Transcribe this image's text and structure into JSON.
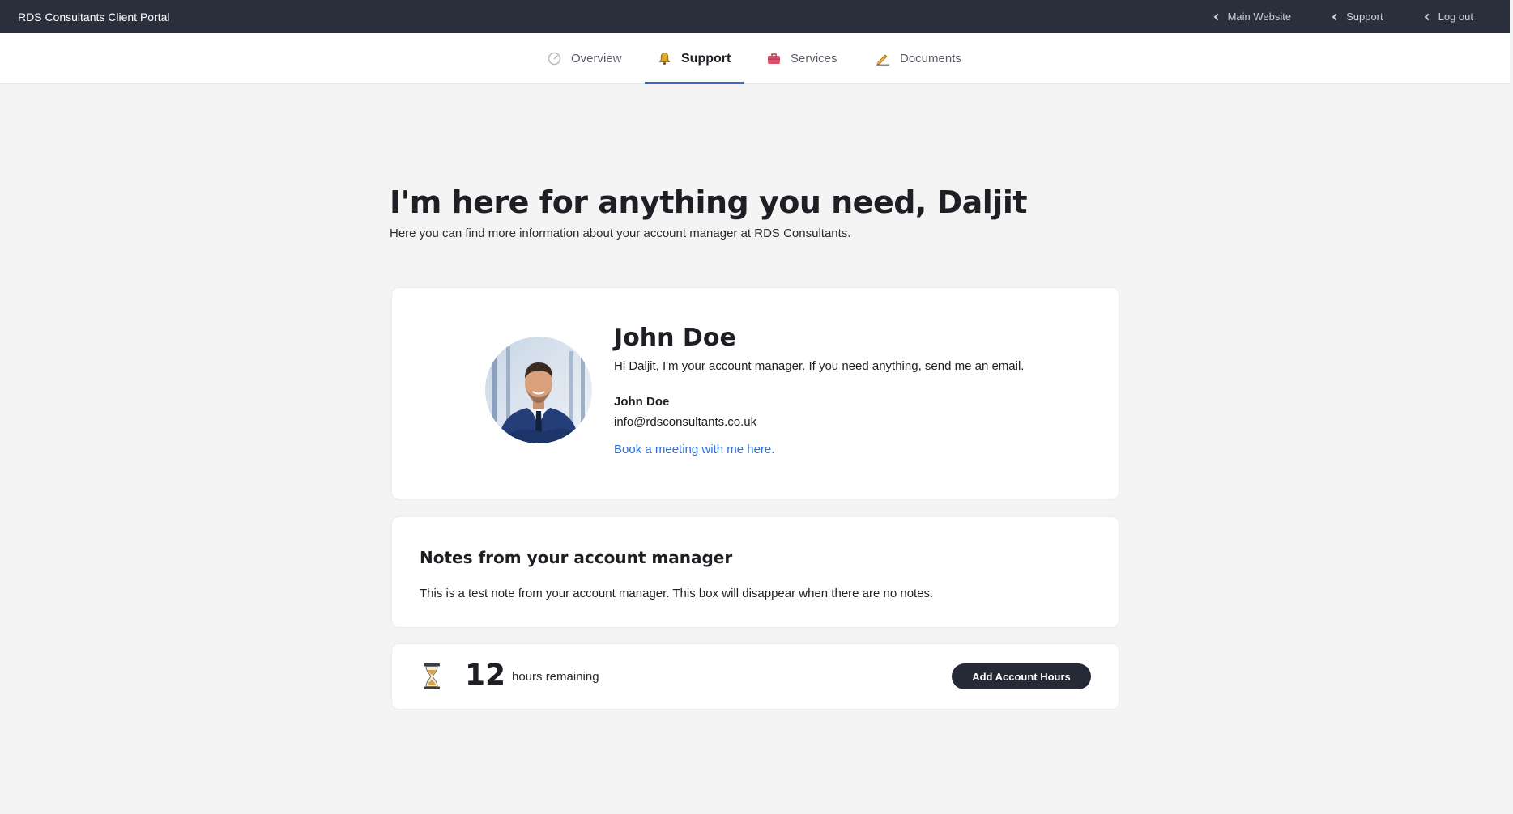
{
  "topbar": {
    "brand": "RDS Consultants Client Portal",
    "links": [
      {
        "label": "Main Website",
        "icon": "chevron-left-icon"
      },
      {
        "label": "Support",
        "icon": "chevron-left-icon"
      },
      {
        "label": "Log out",
        "icon": "chevron-left-icon"
      }
    ]
  },
  "tabs": [
    {
      "label": "Overview",
      "icon": "gauge-icon",
      "active": false
    },
    {
      "label": "Support",
      "icon": "bell-icon",
      "active": true
    },
    {
      "label": "Services",
      "icon": "briefcase-icon",
      "active": false
    },
    {
      "label": "Documents",
      "icon": "signature-icon",
      "active": false
    }
  ],
  "page": {
    "heading": "I'm here for anything you need, Daljit",
    "subheading": "Here you can find more information about your account manager at RDS Consultants."
  },
  "manager": {
    "name": "John Doe",
    "intro": "Hi Daljit, I'm your account manager. If you need anything, send me an email.",
    "signature": "John Doe",
    "email": "info@rdsconsultants.co.uk",
    "meeting_link": "Book a meeting with me here."
  },
  "notes": {
    "title": "Notes from your account manager",
    "body": "This is a test note from your account manager. This box will disappear when there are no notes."
  },
  "hours": {
    "remaining": "12",
    "label": "hours remaining",
    "button": "Add Account Hours",
    "icon": "hourglass-icon"
  },
  "colors": {
    "topbar": "#2b2f3c",
    "accent": "#3a66d1",
    "link": "#2f6fd6",
    "button": "#262a36",
    "background": "#f4f4f5"
  }
}
